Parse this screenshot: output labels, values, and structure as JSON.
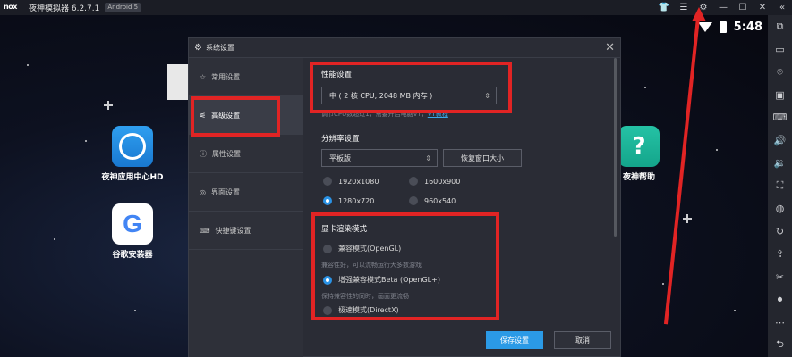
{
  "titlebar": {
    "logo": "nox",
    "title": "夜神模拟器 6.2.7.1",
    "android": "Android 5",
    "buttons": [
      "👕",
      "☰",
      "⚙",
      "—",
      "☐",
      "✕",
      "«"
    ]
  },
  "status": {
    "time": "5:48"
  },
  "desktop_apps": [
    {
      "label": "夜神应用中心HD"
    },
    {
      "label": "谷歌安装器"
    },
    {
      "label": "夜神帮助"
    }
  ],
  "dialog": {
    "title": "系统设置",
    "nav": [
      {
        "label": "常用设置",
        "icon": "star-icon"
      },
      {
        "label": "高级设置",
        "icon": "sliders-icon"
      },
      {
        "label": "属性设置",
        "icon": "info-icon"
      },
      {
        "label": "界面设置",
        "icon": "palette-icon"
      },
      {
        "label": "快捷键设置",
        "icon": "keyboard-icon"
      }
    ],
    "performance": {
      "title": "性能设置",
      "value": "中 ( 2 核 CPU, 2048 MB 内存 )",
      "hint_text": "调节CPU数超过1，需要开启电脑VT，",
      "hint_link": "VT教程"
    },
    "resolution": {
      "title": "分辨率设置",
      "value": "平板版",
      "restore_button": "恢复窗口大小",
      "options": [
        "1920x1080",
        "1600x900",
        "1280x720",
        "960x540"
      ],
      "selected": "1280x720"
    },
    "render": {
      "title": "显卡渲染模式",
      "options": [
        {
          "label": "兼容模式(OpenGL)",
          "desc": "兼容性好，可以流畅运行大多数游戏"
        },
        {
          "label": "增强兼容模式Beta (OpenGL+)",
          "desc": "保持兼容性的同时，画面更流畅"
        },
        {
          "label": "极速模式(DirectX)",
          "desc": ""
        }
      ],
      "selected": "增强兼容模式Beta (OpenGL+)"
    },
    "footer": {
      "save": "保存设置",
      "cancel": "取消"
    }
  },
  "colors": {
    "accent": "#2b9ae6",
    "annotation": "#e12424"
  }
}
